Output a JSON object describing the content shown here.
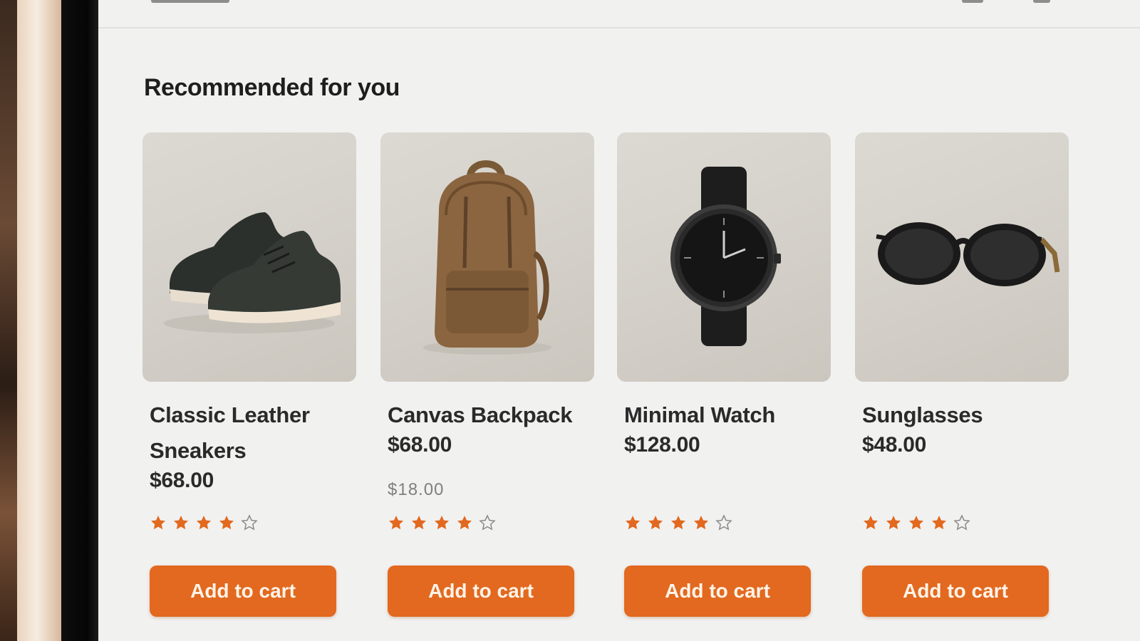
{
  "section": {
    "title": "Recommended for you"
  },
  "accent_color": "#e2691f",
  "products": [
    {
      "name": "Classic Leather Sneakers",
      "price": "$68.00",
      "sub_price": "",
      "rating": 4,
      "button": "Add to cart",
      "image": "sneakers"
    },
    {
      "name": "Canvas Backpack",
      "price": "$68.00",
      "sub_price": "$18.00",
      "rating": 4,
      "button": "Add to cart",
      "image": "backpack"
    },
    {
      "name": "Minimal Watch",
      "price": "$128.00",
      "sub_price": "",
      "rating": 4,
      "button": "Add to cart",
      "image": "watch"
    },
    {
      "name": "Sunglasses",
      "price": "$48.00",
      "sub_price": "",
      "rating": 4,
      "button": "Add to cart",
      "image": "sunglasses"
    }
  ]
}
